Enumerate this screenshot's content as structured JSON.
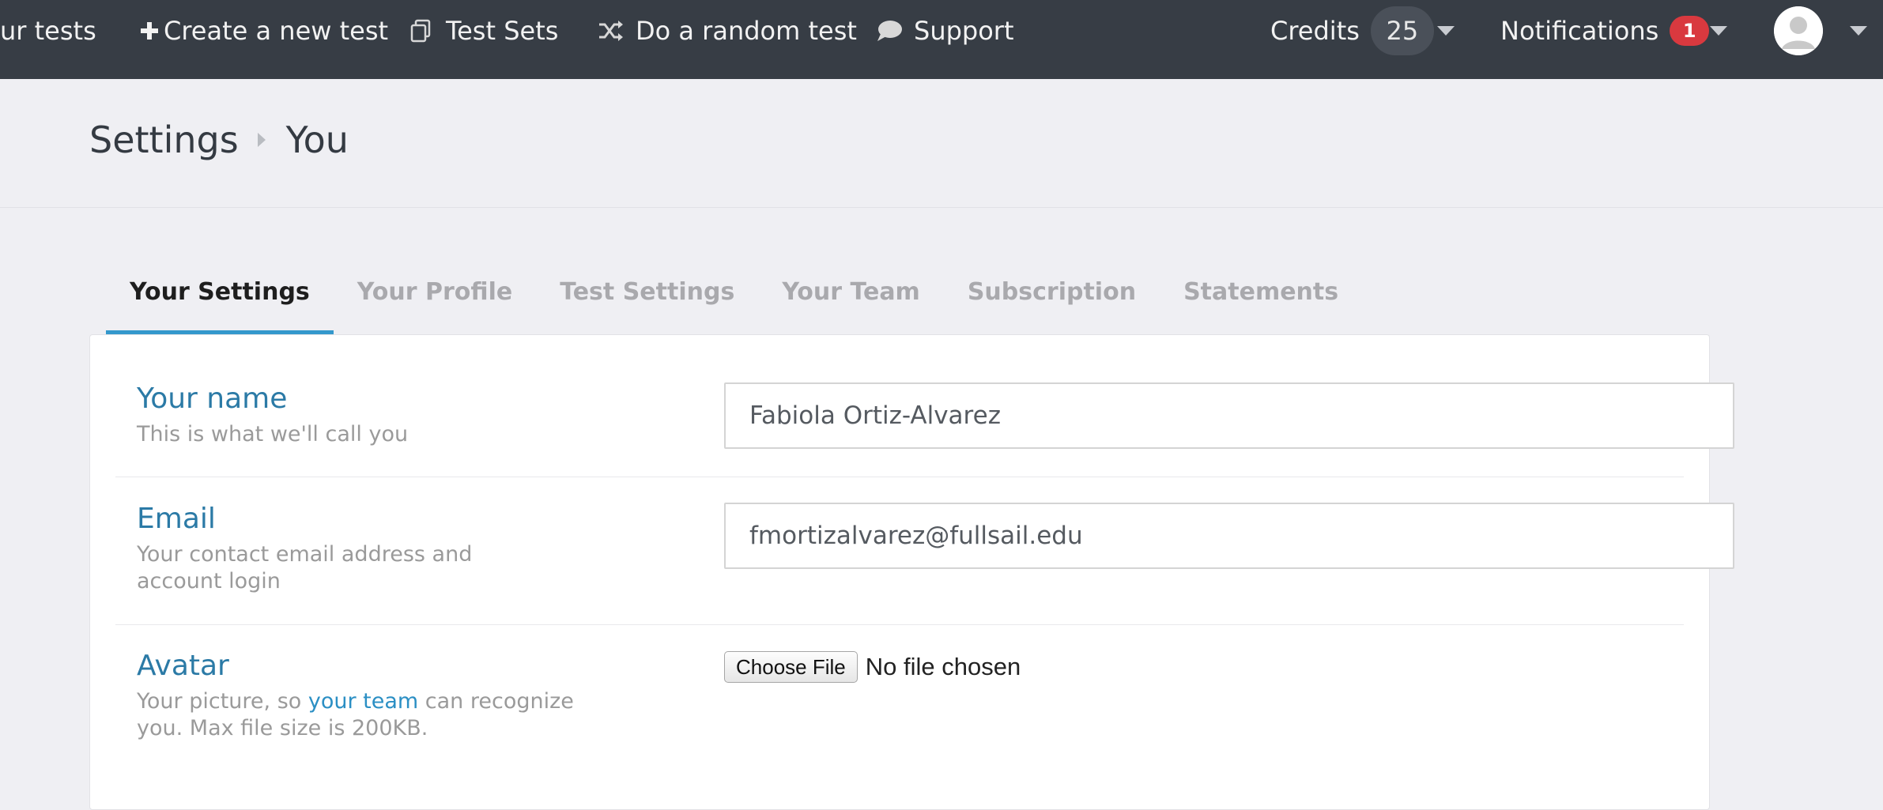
{
  "nav": {
    "your_tests": "ur tests",
    "create": "Create a new test",
    "test_sets": "Test Sets",
    "random": "Do a random test",
    "support": "Support",
    "credits_label": "Credits",
    "credits_value": "25",
    "notifications_label": "Notifications",
    "notifications_count": "1"
  },
  "breadcrumb": {
    "root": "Settings",
    "current": "You"
  },
  "tabs": [
    {
      "label": "Your Settings",
      "active": true
    },
    {
      "label": "Your Profile",
      "active": false
    },
    {
      "label": "Test Settings",
      "active": false
    },
    {
      "label": "Your Team",
      "active": false
    },
    {
      "label": "Subscription",
      "active": false
    },
    {
      "label": "Statements",
      "active": false
    }
  ],
  "form": {
    "name": {
      "label": "Your name",
      "help": "This is what we'll call you",
      "value": "Fabiola Ortiz-Alvarez"
    },
    "email": {
      "label": "Email",
      "help": "Your contact email address and account login",
      "value": "fmortizalvarez@fullsail.edu"
    },
    "avatar": {
      "label": "Avatar",
      "help_before": "Your picture, so ",
      "help_link": "your team",
      "help_after": " can recognize you. Max file size is 200KB.",
      "button": "Choose File",
      "status": "No file chosen"
    }
  },
  "colors": {
    "nav_bg": "#373d45",
    "accent": "#3498cc",
    "label": "#2b7aa6",
    "badge": "#d9393f"
  }
}
